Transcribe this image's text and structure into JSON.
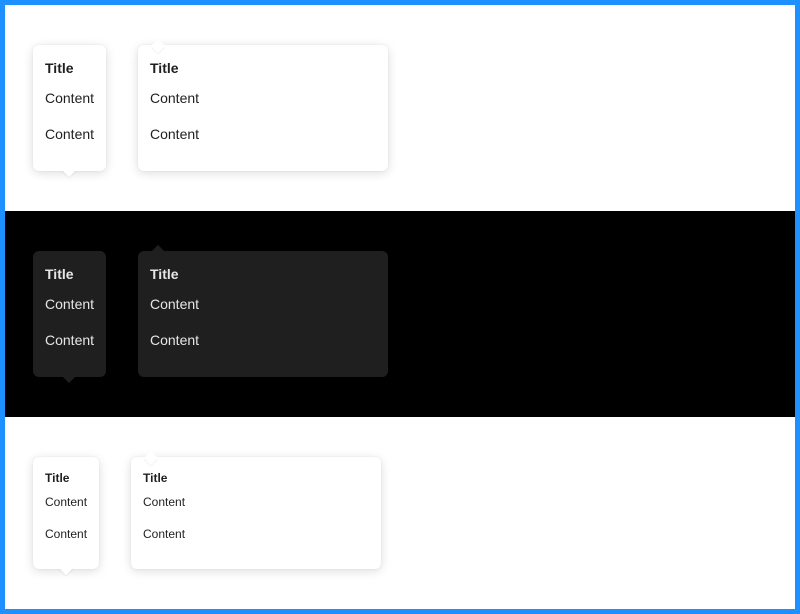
{
  "colors": {
    "frame_border": "#1e90ff",
    "light_background": "#ffffff",
    "dark_background": "#000000",
    "light_popover": "#ffffff",
    "dark_popover": "#1f1f1f"
  },
  "light_row": {
    "narrow": {
      "title": "Title",
      "content": [
        "Content",
        "Content"
      ]
    },
    "wide": {
      "title": "Title",
      "content": [
        "Content",
        "Content"
      ]
    }
  },
  "dark_row": {
    "narrow": {
      "title": "Title",
      "content": [
        "Content",
        "Content"
      ]
    },
    "wide": {
      "title": "Title",
      "content": [
        "Content",
        "Content"
      ]
    }
  },
  "small_row": {
    "narrow": {
      "title": "Title",
      "content": [
        "Content",
        "Content"
      ]
    },
    "wide": {
      "title": "Title",
      "content": [
        "Content",
        "Content"
      ]
    }
  }
}
